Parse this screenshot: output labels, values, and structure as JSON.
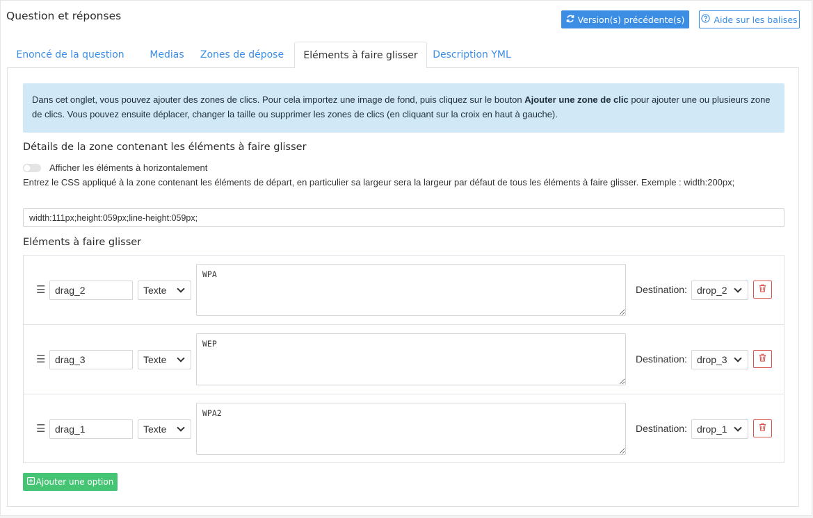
{
  "header": {
    "title": "Question et réponses",
    "version_button": "Version(s) précédente(s)",
    "help_button": "Aide sur les balises"
  },
  "tabs": [
    {
      "label": "Enoncé de la question",
      "active": false
    },
    {
      "label": "Medias",
      "active": false
    },
    {
      "label": "Zones de dépose",
      "active": false
    },
    {
      "label": "Eléments à faire glisser",
      "active": true
    },
    {
      "label": "Description YML",
      "active": false
    }
  ],
  "info": {
    "text_before": "Dans cet onglet, vous pouvez ajouter des zones de clics. Pour cela importez une image de fond, puis cliquez sur le bouton ",
    "text_bold": "Ajouter une zone de clic",
    "text_after": " pour ajouter une ou plusieurs zone de clics. Vous pouvez ensuite déplacer, changer la taille ou supprimer les zones de clics (en cliquant sur la croix en haut à gauche)."
  },
  "zone": {
    "title": "Détails de la zone contenant les éléments à faire glisser",
    "toggle_label": "Afficher les éléments à horizontalement",
    "toggle_on": false,
    "css_help": "Entrez le CSS appliqué à la zone contenant les éléments de départ, en particulier sa largeur sera la largeur par défaut de tous les éléments à faire glisser. Exemple : width:200px;",
    "css_value": "width:111px;height:059px;line-height:059px;"
  },
  "elements": {
    "title": "Eléments à faire glisser",
    "destination_label": "Destination:",
    "rows": [
      {
        "id": "drag_2",
        "type": "Texte",
        "text": "WPA",
        "destination": "drop_2"
      },
      {
        "id": "drag_3",
        "type": "Texte",
        "text": "WEP",
        "destination": "drop_3"
      },
      {
        "id": "drag_1",
        "type": "Texte",
        "text": "WPA2",
        "destination": "drop_1"
      }
    ],
    "add_button": "Ajouter une option"
  },
  "colors": {
    "primary": "#3b8ee4",
    "info_bg": "#d1e9f6",
    "success": "#45c474",
    "danger": "#d9534f"
  }
}
